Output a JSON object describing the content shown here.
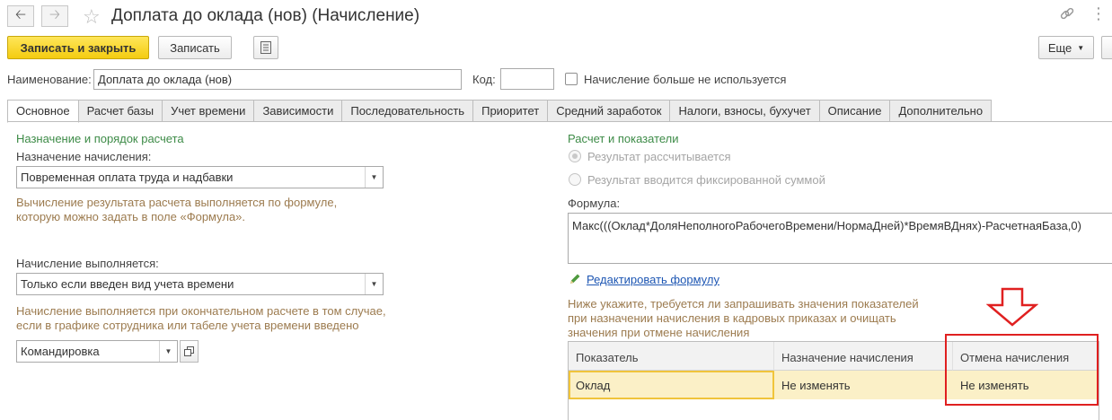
{
  "window": {
    "title": "Доплата до оклада (нов) (Начисление)"
  },
  "toolbar": {
    "write_close_label": "Записать и закрыть",
    "write_label": "Записать",
    "more_label": "Еще"
  },
  "header": {
    "name_label": "Наименование:",
    "name_value": "Доплата до оклада (нов)",
    "code_label": "Код:",
    "code_value": "",
    "unused_checkbox_label": "Начисление больше не используется"
  },
  "tabs": [
    {
      "label": "Основное",
      "active": true
    },
    {
      "label": "Расчет базы"
    },
    {
      "label": "Учет времени"
    },
    {
      "label": "Зависимости"
    },
    {
      "label": "Последовательность"
    },
    {
      "label": "Приоритет"
    },
    {
      "label": "Средний заработок"
    },
    {
      "label": "Налоги, взносы, бухучет"
    },
    {
      "label": "Описание"
    },
    {
      "label": "Дополнительно"
    }
  ],
  "left": {
    "section_title": "Назначение и порядок расчета",
    "purpose_label": "Назначение начисления:",
    "purpose_value": "Повременная оплата труда и надбавки",
    "purpose_hint_1": "Вычисление результата расчета выполняется по формуле,",
    "purpose_hint_2": "которую можно задать в поле «Формула».",
    "execution_label": "Начисление выполняется:",
    "execution_value": "Только если введен вид учета времени",
    "execution_hint_1": "Начисление выполняется при окончательном расчете в том случае,",
    "execution_hint_2": "если в графике сотрудника или табеле учета времени введено",
    "time_type_value": "Командировка"
  },
  "right": {
    "section_title": "Расчет и показатели",
    "radio_calculated": "Результат рассчитывается",
    "radio_fixed": "Результат вводится фиксированной суммой",
    "formula_label": "Формула:",
    "formula_value": "Макс(((Оклад*ДоляНеполногоРабочегоВремени/НормаДней)*ВремяВДнях)-РасчетнаяБаза,0)",
    "edit_formula_link": "Редактировать формулу",
    "indicators_hint_1": "Ниже укажите, требуется ли запрашивать значения показателей",
    "indicators_hint_2": "при назначении начисления в кадровых приказах и очищать",
    "indicators_hint_3": "значения при отмене начисления"
  },
  "indicators_table": {
    "columns": [
      "Показатель",
      "Назначение начисления",
      "Отмена начисления"
    ],
    "rows": [
      [
        "Оклад",
        "Не изменять",
        "Не изменять"
      ]
    ]
  },
  "colors": {
    "primary_button": "#f4cc10",
    "section_title": "#3d8b47",
    "hint_text": "#9c7b4f",
    "link": "#1d56b3",
    "annotation": "#e02020"
  },
  "icons": [
    "back-arrow-icon",
    "forward-arrow-icon",
    "favorite-star-icon",
    "link-icon",
    "more-vertical-icon",
    "list-report-icon",
    "pencil-icon",
    "down-arrow-annotation-icon"
  ]
}
